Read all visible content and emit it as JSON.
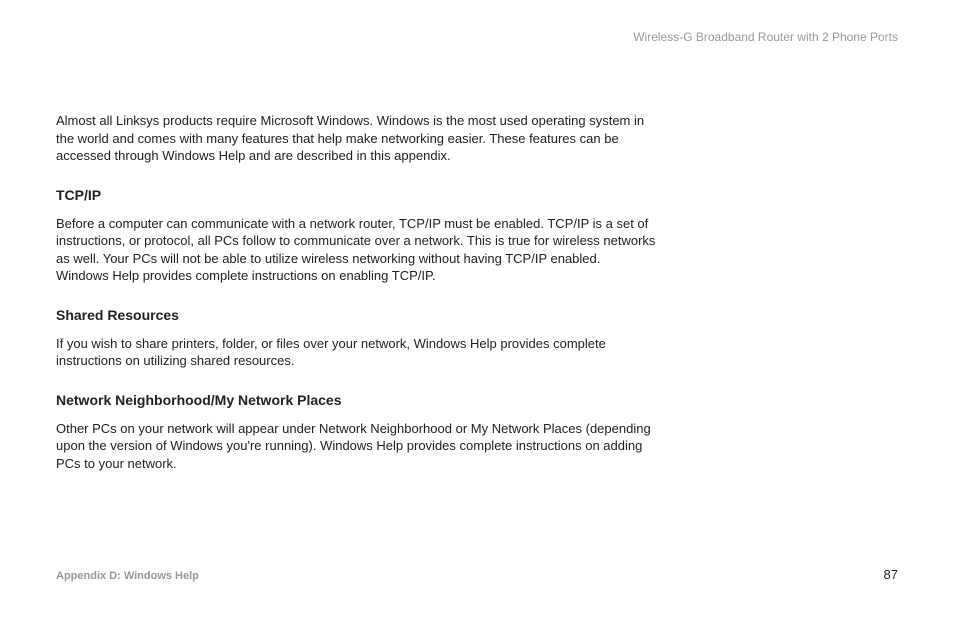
{
  "header": {
    "title": "Wireless-G Broadband Router with 2 Phone Ports"
  },
  "intro": "Almost all Linksys products require Microsoft Windows. Windows is the most used operating system in the world and comes with many features that help make networking easier. These features can be accessed through Windows Help and are described in this appendix.",
  "sections": [
    {
      "heading": "TCP/IP",
      "body": "Before a computer can communicate with a network router, TCP/IP must be enabled. TCP/IP is a set of instructions, or protocol, all PCs follow to communicate over a network. This is true for wireless networks as well. Your PCs will not be able to utilize wireless networking without having TCP/IP enabled. Windows Help provides complete instructions on enabling TCP/IP."
    },
    {
      "heading": "Shared Resources",
      "body": "If you wish to share printers, folder, or files over your network, Windows Help provides complete instructions on utilizing shared resources."
    },
    {
      "heading": "Network Neighborhood/My Network Places",
      "body": "Other PCs on your network will appear under Network Neighborhood or My Network Places (depending upon the version of Windows you're running). Windows Help provides complete instructions on adding PCs to your network."
    }
  ],
  "footer": {
    "appendix": "Appendix D: Windows Help",
    "page_number": "87"
  }
}
